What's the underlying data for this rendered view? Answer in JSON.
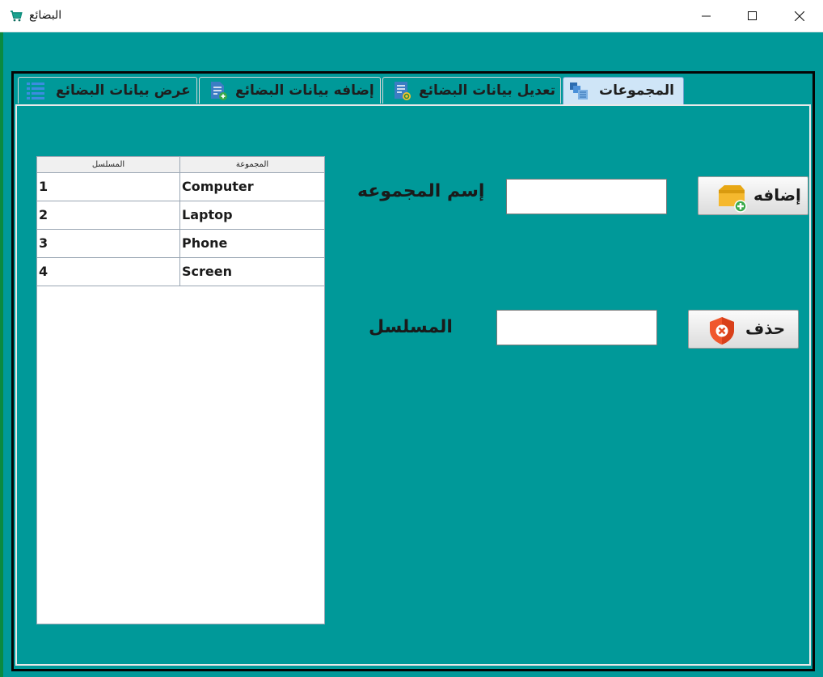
{
  "window": {
    "title": "البضائع",
    "icon": "shopping-cart-icon"
  },
  "tabs": [
    {
      "label": "المجموعات",
      "icon": "groups-icon",
      "active": true
    },
    {
      "label": "تعديل بيانات البضائع",
      "icon": "edit-document-icon",
      "active": false
    },
    {
      "label": "إضافه بيانات البضائع",
      "icon": "add-document-icon",
      "active": false
    },
    {
      "label": "عرض بيانات البضائع",
      "icon": "list-icon",
      "active": false
    }
  ],
  "grid": {
    "columns": [
      "المسلسل",
      "المجموعة"
    ],
    "rows": [
      {
        "serial": "1",
        "group": "Computer"
      },
      {
        "serial": "2",
        "group": "Laptop"
      },
      {
        "serial": "3",
        "group": "Phone"
      },
      {
        "serial": "4",
        "group": "Screen"
      }
    ]
  },
  "form": {
    "group_name_label": "إسم المجموعه",
    "group_name_value": "",
    "serial_label": "المسلسل",
    "serial_value": "",
    "add_label": "إضافه",
    "delete_label": "حذف"
  },
  "colors": {
    "background": "#009999",
    "active_tab": "#cfe5f7"
  }
}
